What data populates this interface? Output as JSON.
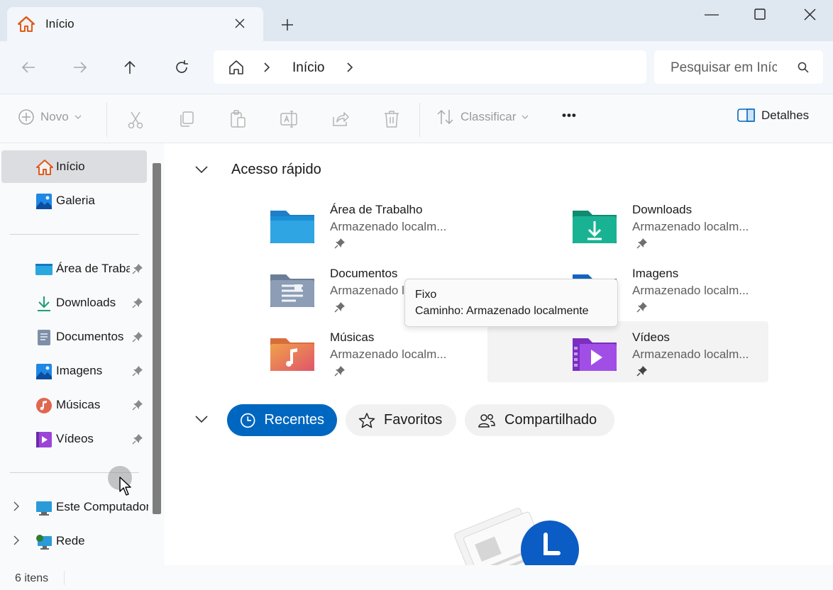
{
  "tab": {
    "title": "Início",
    "new_tab": "+"
  },
  "window_controls": {
    "minimize": "minimize",
    "maximize": "maximize",
    "close": "close"
  },
  "nav": {
    "breadcrumb_current": "Início"
  },
  "search": {
    "placeholder": "Pesquisar em Início"
  },
  "toolbar": {
    "new_label": "Novo",
    "sort_label": "Classificar",
    "more_label": "•••",
    "details_label": "Detalhes"
  },
  "sidebar": {
    "items": [
      {
        "label": "Início",
        "icon": "home-icon"
      },
      {
        "label": "Galeria",
        "icon": "gallery-icon"
      },
      {
        "label": "Área de Trabalho",
        "icon": "desktop-folder-icon",
        "pinned": true
      },
      {
        "label": "Downloads",
        "icon": "download-icon",
        "pinned": true
      },
      {
        "label": "Documentos",
        "icon": "documents-icon",
        "pinned": true
      },
      {
        "label": "Imagens",
        "icon": "pictures-icon",
        "pinned": true
      },
      {
        "label": "Músicas",
        "icon": "music-icon",
        "pinned": true
      },
      {
        "label": "Vídeos",
        "icon": "videos-icon",
        "pinned": true
      },
      {
        "label": "Este Computador",
        "icon": "computer-icon"
      },
      {
        "label": "Rede",
        "icon": "network-icon"
      }
    ]
  },
  "main": {
    "quick_access_title": "Acesso rápido",
    "quick_items": [
      {
        "name": "Área de Trabalho",
        "location": "Armazenado localm...",
        "icon": "desktop-folder-icon"
      },
      {
        "name": "Downloads",
        "location": "Armazenado localm...",
        "icon": "downloads-folder-icon"
      },
      {
        "name": "Documentos",
        "location": "Armazenado localm...",
        "icon": "documents-folder-icon"
      },
      {
        "name": "Imagens",
        "location": "Armazenado localm...",
        "icon": "pictures-folder-icon"
      },
      {
        "name": "Músicas",
        "location": "Armazenado localm...",
        "icon": "music-folder-icon"
      },
      {
        "name": "Vídeos",
        "location": "Armazenado localm...",
        "icon": "videos-folder-icon"
      }
    ],
    "tabs": [
      {
        "label": "Recentes",
        "selected": true
      },
      {
        "label": "Favoritos",
        "selected": false
      },
      {
        "label": "Compartilhado",
        "selected": false
      }
    ]
  },
  "tooltip": {
    "line1": "Fixo",
    "line2": "Caminho: Armazenado localmente"
  },
  "status": {
    "count": "6 itens"
  },
  "colors": {
    "accent": "#0067c0",
    "titlebar": "#dfe7f1",
    "navbar": "#f3f6fa"
  }
}
